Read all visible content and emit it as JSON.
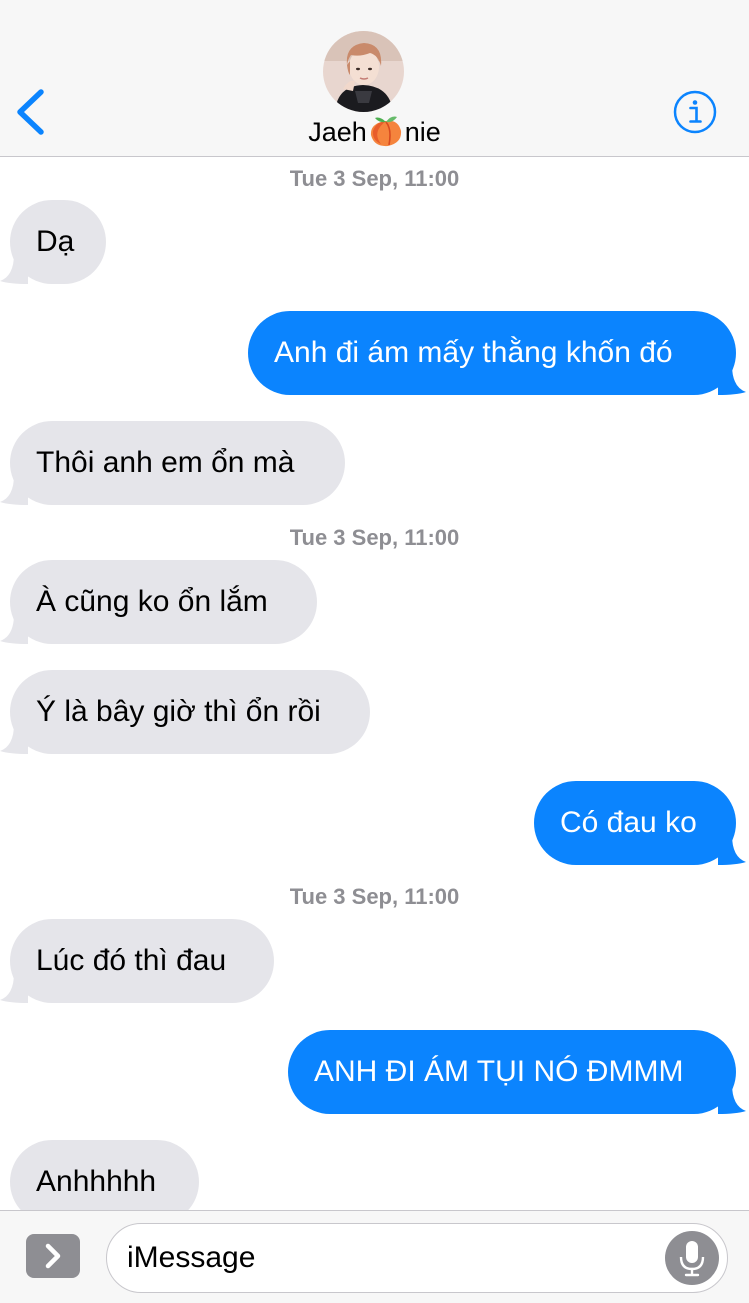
{
  "header": {
    "contact_name_prefix": "Jaeh",
    "contact_name_emoji": "peach-emoji",
    "contact_name_suffix": "nie",
    "back_icon": "chevron-left-icon",
    "info_icon": "info-icon",
    "accent_color": "#0b84fe"
  },
  "conversation": {
    "timestamps": [
      "Tue 3 Sep, 11:00",
      "Tue 3 Sep, 11:00",
      "Tue 3 Sep, 11:00"
    ],
    "messages": [
      {
        "direction": "incoming",
        "text": "Dạ"
      },
      {
        "direction": "outgoing",
        "text": "Anh đi ám mấy thằng khốn đó"
      },
      {
        "direction": "incoming",
        "text": "Thôi anh em ổn mà"
      },
      {
        "direction": "incoming",
        "text": "À cũng ko ổn lắm"
      },
      {
        "direction": "incoming",
        "text": "Ý là bây giờ thì ổn rồi"
      },
      {
        "direction": "outgoing",
        "text": "Có đau ko"
      },
      {
        "direction": "incoming",
        "text": "Lúc đó thì đau"
      },
      {
        "direction": "outgoing",
        "text": "ANH ĐI ÁM TỤI NÓ ĐMMM"
      },
      {
        "direction": "incoming",
        "text": "Anhhhhh"
      }
    ],
    "incoming_color": "#e5e5ea",
    "outgoing_color": "#0b84fe"
  },
  "composer": {
    "placeholder": "iMessage",
    "expand_icon": "chevron-right-icon",
    "mic_icon": "microphone-icon"
  }
}
